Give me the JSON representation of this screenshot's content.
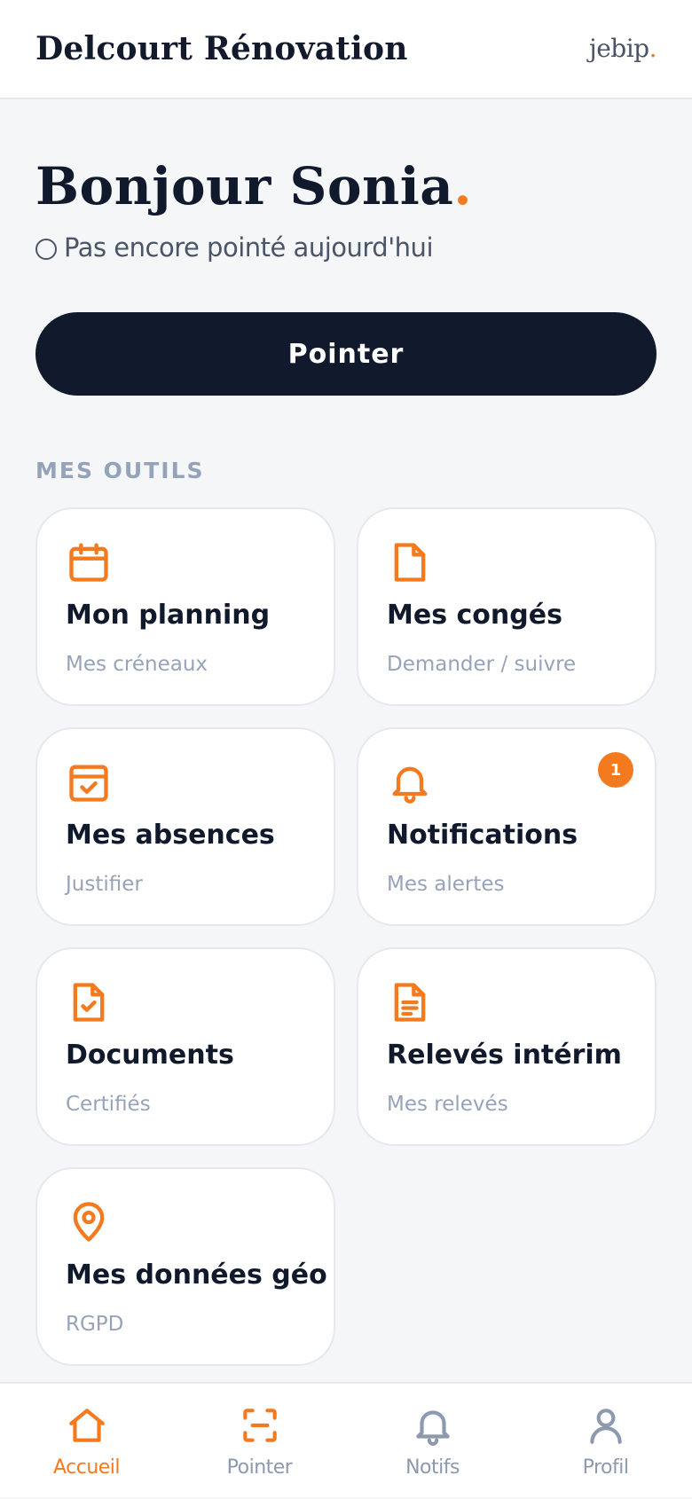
{
  "header": {
    "company": "Delcourt Rénovation",
    "brand_name": "jebip",
    "brand_dot": "."
  },
  "greeting": {
    "text": "Bonjour Sonia",
    "dot": "."
  },
  "status": {
    "text": "Pas encore pointé aujourd'hui"
  },
  "actions": {
    "pointer_label": "Pointer"
  },
  "tools": {
    "section_title": "MES OUTILS",
    "items": [
      {
        "title": "Mon planning",
        "subtitle": "Mes créneaux",
        "icon": "calendar-icon"
      },
      {
        "title": "Mes congés",
        "subtitle": "Demander / suivre",
        "icon": "document-icon"
      },
      {
        "title": "Mes absences",
        "subtitle": "Justifier",
        "icon": "calendar-check-icon"
      },
      {
        "title": "Notifications",
        "subtitle": "Mes alertes",
        "icon": "bell-icon",
        "badge": "1"
      },
      {
        "title": "Documents",
        "subtitle": "Certifiés",
        "icon": "file-check-icon"
      },
      {
        "title": "Relevés intérim",
        "subtitle": "Mes relevés",
        "icon": "file-text-icon"
      },
      {
        "title": "Mes données géo",
        "subtitle": "RGPD",
        "icon": "map-pin-icon"
      }
    ]
  },
  "tabbar": {
    "items": [
      {
        "label": "Accueil",
        "icon": "home-icon",
        "active": true
      },
      {
        "label": "Pointer",
        "icon": "scan-icon",
        "active": false
      },
      {
        "label": "Notifs",
        "icon": "bell-icon",
        "active": false
      },
      {
        "label": "Profil",
        "icon": "user-icon",
        "active": false
      }
    ]
  },
  "colors": {
    "accent": "#f47a1f",
    "dark": "#111a2c",
    "muted": "#97a3b8",
    "background": "#f5f6f8"
  }
}
